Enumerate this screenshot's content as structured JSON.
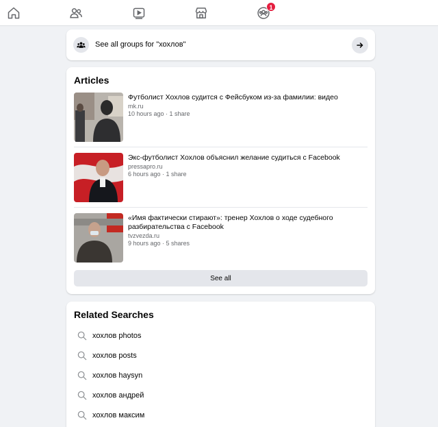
{
  "nav": {
    "items": [
      {
        "icon": "home-icon"
      },
      {
        "icon": "friends-icon"
      },
      {
        "icon": "watch-icon"
      },
      {
        "icon": "marketplace-icon"
      },
      {
        "icon": "groups-icon",
        "badge": "1"
      }
    ]
  },
  "groups_link": {
    "text": "See all groups for \"хохлов\"",
    "icon": "groups-icon",
    "arrow_icon": "arrow-right-icon"
  },
  "articles": {
    "title": "Articles",
    "items": [
      {
        "title": "Футболист Хохлов судится с Фейсбуком из-за фамилии: видео",
        "source": "mk.ru",
        "meta": "10 hours ago · 1 share"
      },
      {
        "title": "Экс-футболист Хохлов объяснил желание судиться с Facebook",
        "source": "pressapro.ru",
        "meta": "6 hours ago · 1 share"
      },
      {
        "title": "«Имя фактически стирают»: тренер Хохлов о ходе судебного разбирательства с Facebook",
        "source": "tvzvezda.ru",
        "meta": "9 hours ago · 5 shares"
      }
    ],
    "see_all": "See all"
  },
  "related": {
    "title": "Related Searches",
    "items": [
      {
        "text": "хохлов photos"
      },
      {
        "text": "хохлов posts"
      },
      {
        "text": "хохлов haysyn"
      },
      {
        "text": "хохлов андрей"
      },
      {
        "text": "хохлов максим"
      }
    ]
  },
  "colors": {
    "background": "#f0f2f5",
    "card": "#ffffff",
    "badge": "#e41e3f",
    "secondary_text": "#65676b",
    "button_gray": "#e4e6eb"
  }
}
